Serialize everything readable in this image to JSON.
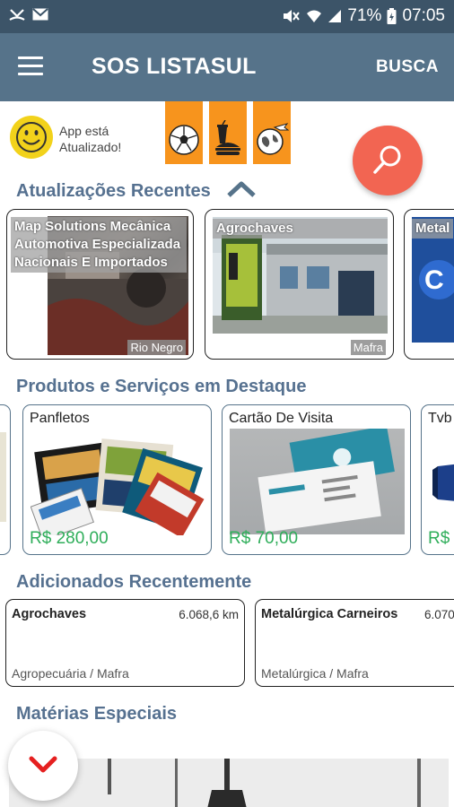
{
  "status_bar": {
    "battery": "71%",
    "time": "07:05",
    "icons": [
      "call-missed-icon",
      "mail-icon",
      "mute-icon",
      "wifi-icon",
      "signal-icon",
      "battery-icon"
    ]
  },
  "app_bar": {
    "title": "SOS LISTASUL",
    "search_label": "BUSCA",
    "menu_icon": "hamburger-icon",
    "color": "#56738a"
  },
  "promo": {
    "status_line1": "App está",
    "status_line2": "Atualizado!",
    "categories": [
      "soccer-ball-icon",
      "fast-food-icon",
      "travel-globe-icon"
    ],
    "accent": "#f7941d",
    "search_fab_color": "#f26552"
  },
  "sections": {
    "recent_updates": "Atualizações Recentes",
    "featured": "Produtos e Serviços em Destaque",
    "recently_added": "Adicionados Recentemente",
    "special": "Matérias Especiais"
  },
  "recent_updates": [
    {
      "label": "Map Solutions Mecânica  Automotiva Especializada Nacionais E Importados",
      "location": "Rio Negro"
    },
    {
      "label": "Agrochaves",
      "location": "Mafra"
    },
    {
      "label": "Metal",
      "location": ""
    }
  ],
  "featured": [
    {
      "name": "Panfletos",
      "price": "R$ 280,00"
    },
    {
      "name": "Cartão De Visita",
      "price": "R$ 70,00"
    },
    {
      "name": "Tvb",
      "price": "R$"
    }
  ],
  "recently_added": [
    {
      "name": "Agrochaves",
      "distance": "6.068,6 km",
      "category": "Agropecuária / Mafra"
    },
    {
      "name": "Metalúrgica Carneiros",
      "distance": "6.070",
      "category": "Metalúrgica / Mafra"
    }
  ],
  "colors": {
    "heading": "#567190",
    "price": "#2fae5a",
    "status_bar": "#3c5468"
  }
}
